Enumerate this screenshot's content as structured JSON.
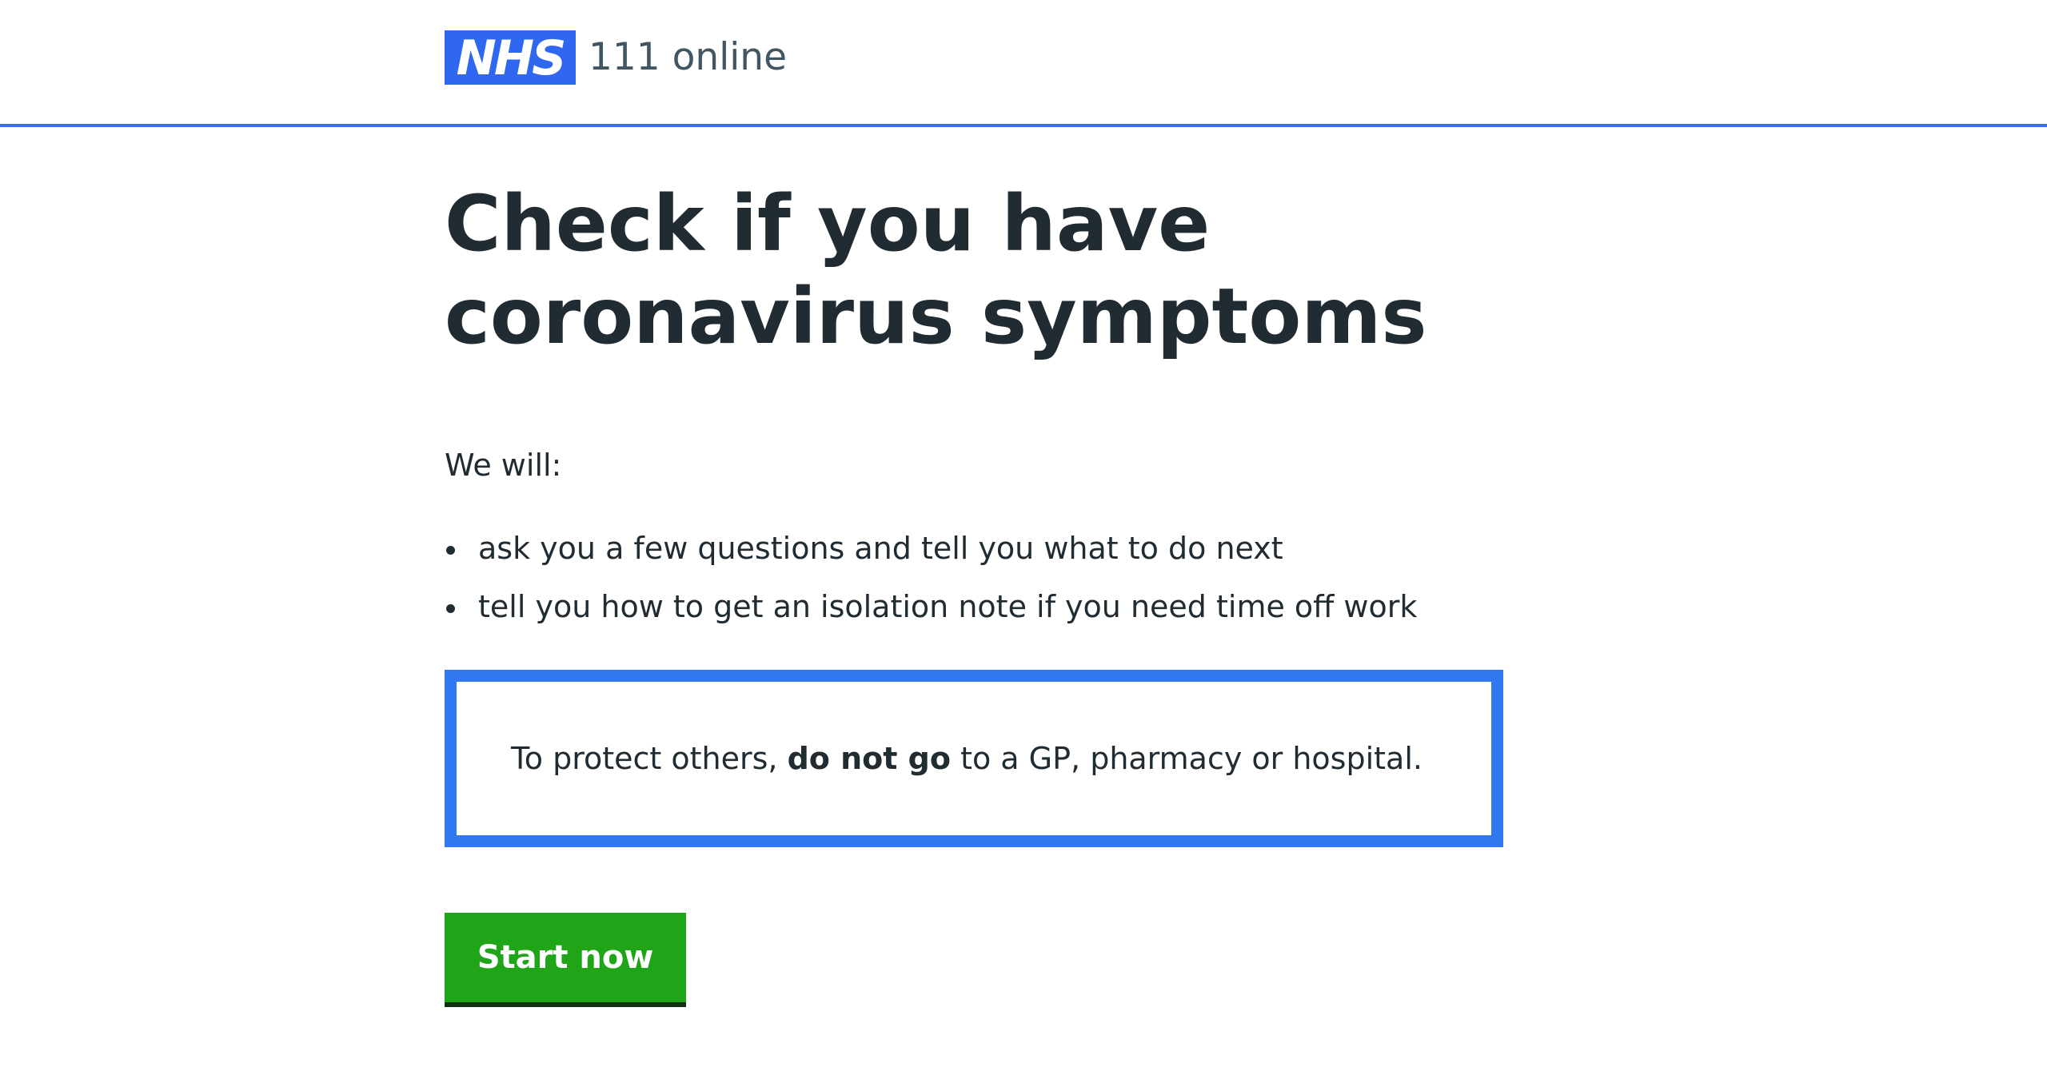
{
  "header": {
    "logo_text": "NHS",
    "service_name": "111 online"
  },
  "main": {
    "title": "Check if you have coronavirus symptoms",
    "intro": "We will:",
    "bullets": [
      "ask you a few questions and tell you what to do next",
      "tell you how to get an isolation note if you need time off work"
    ],
    "callout": {
      "before": "To protect others, ",
      "bold": "do not go",
      "after": " to a GP, pharmacy or hospital."
    },
    "start_button": "Start now"
  },
  "colors": {
    "nhs_blue": "#2f67f0",
    "header_rule": "#3a6fe0",
    "callout_border": "#3078f0",
    "button_green": "#1fa517",
    "button_shadow": "#132f12",
    "text": "#212b32"
  }
}
